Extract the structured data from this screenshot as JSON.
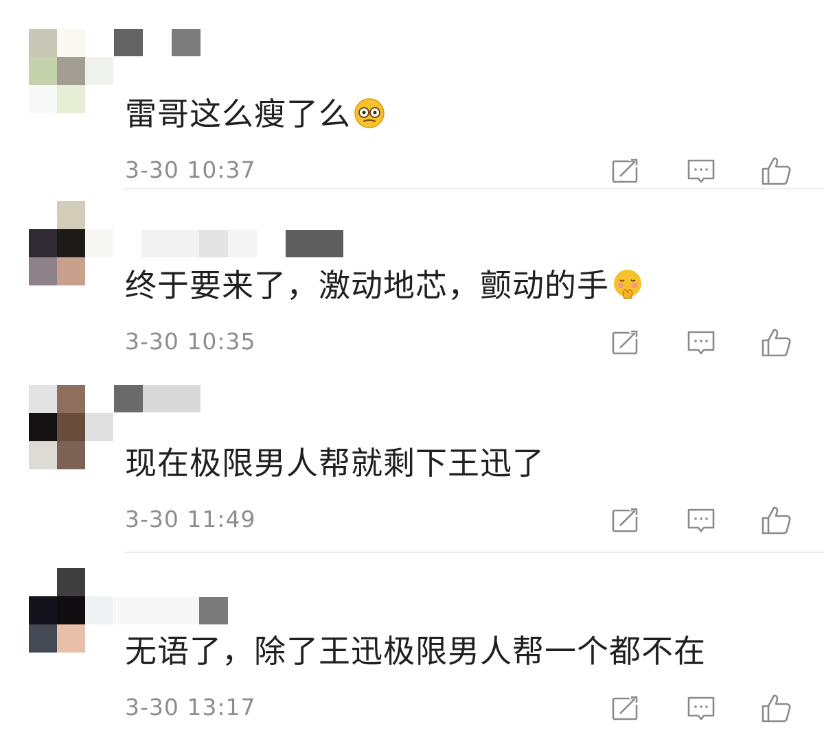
{
  "comments": [
    {
      "text": "雷哥这么瘦了么",
      "emoji": "thinking-face-emoji",
      "time": "3-30 10:37",
      "avatar_colors": [
        "#c9c8b6",
        "#fbf7f1",
        "#ffffff",
        "#c4d2ac",
        "#a39e92",
        "#eef2ea",
        "#f8f8f8",
        "#e6efd6",
        "#ffffff"
      ],
      "name_colors": [
        "#636363",
        "#7c7c7c"
      ]
    },
    {
      "text": "终于要来了，激动地芯，颤动的手",
      "emoji": "flushed-hands-emoji",
      "time": "3-30 10:35",
      "avatar_colors": [
        "#ffffff",
        "#d1cdb8",
        "#ffffff",
        "#2f2a33",
        "#1d1b18",
        "#f6f7f2",
        "#8e8288",
        "#c9a08c",
        "#ffffff"
      ],
      "name_colors": [
        "#e6e6e6",
        "#5e5e5e"
      ]
    },
    {
      "text": "现在极限男人帮就剩下王迅了",
      "emoji": "",
      "time": "3-30 11:49",
      "avatar_colors": [
        "#e3e3e3",
        "#8e6e5c",
        "#ffffff",
        "#141212",
        "#6a4c3a",
        "#e0e0e0",
        "#dcdcd4",
        "#7c6252",
        "#ffffff"
      ],
      "name_colors": [
        "#6a6a6a",
        "#d9d9d9"
      ]
    },
    {
      "text": "无语了，除了王迅极限男人帮一个都不在",
      "emoji": "",
      "time": "3-30 13:17",
      "avatar_colors": [
        "#ffffff",
        "#3e3e3e",
        "#ffffff",
        "#14121a",
        "#0f0d10",
        "#eef0f4",
        "#434a56",
        "#e8c0aa",
        "#ffffff"
      ],
      "name_colors": [
        "#7a7a7a"
      ]
    }
  ],
  "actions": {
    "share_icon": "share-icon",
    "reply_icon": "reply-icon",
    "like_icon": "thumbs-up-icon"
  }
}
